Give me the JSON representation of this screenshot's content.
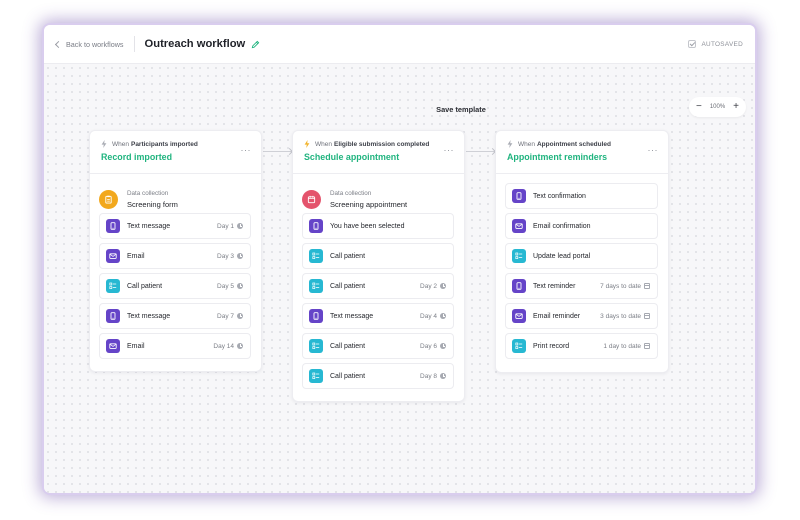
{
  "header": {
    "back_label": "Back to workflows",
    "title": "Outreach workflow",
    "autosaved_label": "AUTOSAVED"
  },
  "canvas": {
    "save_template_label": "Save template",
    "zoom": {
      "minus": "−",
      "value": "100%",
      "plus": "+"
    }
  },
  "colors": {
    "accent_green": "#20b47f",
    "purple_step": "#6544c8",
    "teal_step": "#27b8d2",
    "orange_form": "#f2a81d",
    "red_form": "#e4536c"
  },
  "cards": [
    {
      "trigger_prefix": "When",
      "trigger": "Participants imported",
      "title": "Record imported",
      "more": "···",
      "data_collection": {
        "label": "Data collection",
        "value": "Screening form",
        "icon": "clipboard-icon",
        "color": "#f2a81d"
      },
      "steps": [
        {
          "label": "Text message",
          "timing": "Day 1",
          "icon": "phone-icon",
          "timing_icon": "clock-icon"
        },
        {
          "label": "Email",
          "timing": "Day 3",
          "icon": "mail-icon",
          "timing_icon": "clock-icon"
        },
        {
          "label": "Call patient",
          "timing": "Day 5",
          "icon": "call-list-icon",
          "timing_icon": "clock-icon"
        },
        {
          "label": "Text message",
          "timing": "Day 7",
          "icon": "phone-icon",
          "timing_icon": "clock-icon"
        },
        {
          "label": "Email",
          "timing": "Day 14",
          "icon": "mail-icon",
          "timing_icon": "clock-icon"
        }
      ]
    },
    {
      "trigger_prefix": "When",
      "trigger": "Eligible submission completed",
      "title": "Schedule appointment",
      "more": "···",
      "data_collection": {
        "label": "Data collection",
        "value": "Screening appointment",
        "icon": "calendar-form-icon",
        "color": "#e4536c"
      },
      "steps": [
        {
          "label": "You have been selected",
          "timing": "",
          "icon": "phone-icon",
          "timing_icon": ""
        },
        {
          "label": "Call patient",
          "timing": "",
          "icon": "call-list-icon",
          "timing_icon": ""
        },
        {
          "label": "Call patient",
          "timing": "Day 2",
          "icon": "call-list-icon",
          "timing_icon": "clock-icon"
        },
        {
          "label": "Text message",
          "timing": "Day 4",
          "icon": "phone-icon",
          "timing_icon": "clock-icon"
        },
        {
          "label": "Call patient",
          "timing": "Day 6",
          "icon": "call-list-icon",
          "timing_icon": "clock-icon"
        },
        {
          "label": "Call patient",
          "timing": "Day 8",
          "icon": "call-list-icon",
          "timing_icon": "clock-icon"
        }
      ]
    },
    {
      "trigger_prefix": "When",
      "trigger": "Appointment scheduled",
      "title": "Appointment reminders",
      "more": "···",
      "steps": [
        {
          "label": "Text confirmation",
          "timing": "",
          "icon": "phone-icon",
          "timing_icon": ""
        },
        {
          "label": "Email confirmation",
          "timing": "",
          "icon": "mail-icon",
          "timing_icon": ""
        },
        {
          "label": "Update lead portal",
          "timing": "",
          "icon": "call-list-icon",
          "timing_icon": ""
        },
        {
          "label": "Text reminder",
          "timing": "7 days to date",
          "icon": "phone-icon",
          "timing_icon": "calendar-icon"
        },
        {
          "label": "Email reminder",
          "timing": "3 days to date",
          "icon": "mail-icon",
          "timing_icon": "calendar-icon"
        },
        {
          "label": "Print record",
          "timing": "1 day to date",
          "icon": "call-list-icon",
          "timing_icon": "calendar-icon"
        }
      ]
    }
  ]
}
